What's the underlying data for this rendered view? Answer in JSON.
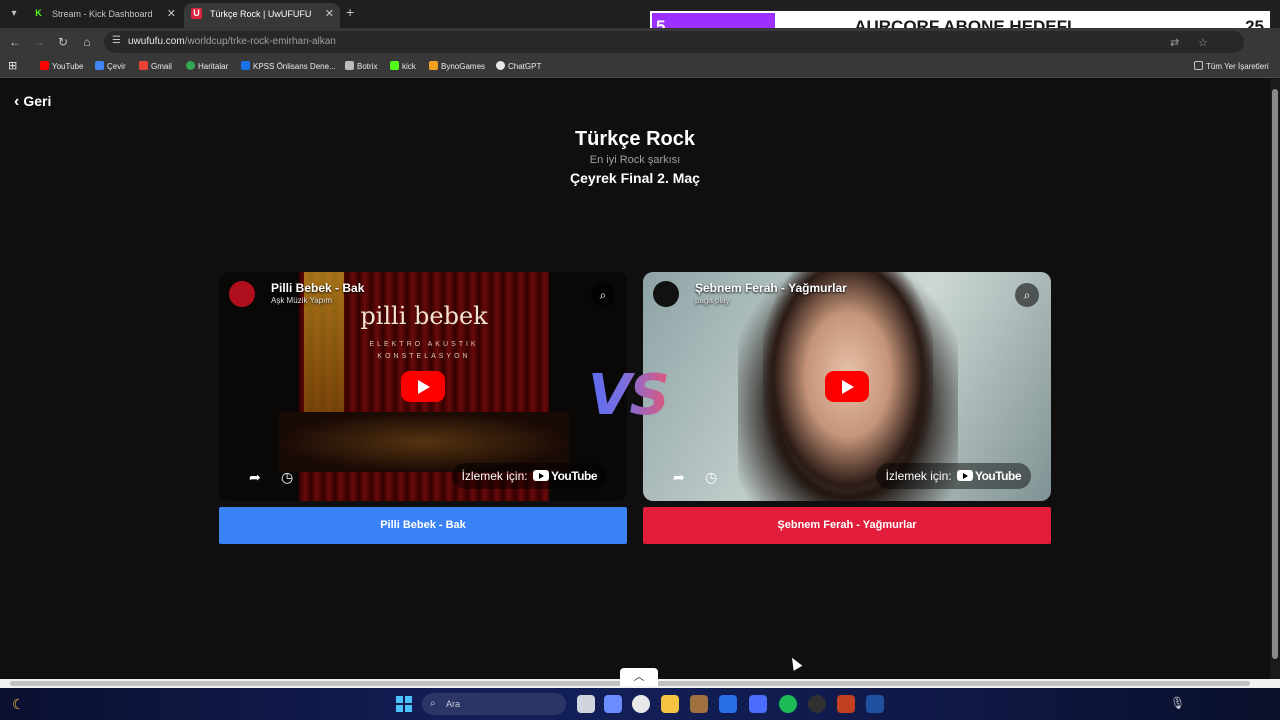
{
  "browser": {
    "tabs": [
      {
        "label": "Stream - Kick Dashboard",
        "favicon": "K"
      },
      {
        "label": "Türkçe Rock | UwUFUFU",
        "favicon": "U"
      }
    ],
    "address": {
      "host": "uwufufu.com",
      "path": "/worldcup/trke-rock-emirhan-alkan"
    },
    "bookmarks": [
      "YouTube",
      "Çevir",
      "Gmail",
      "Haritalar",
      "KPSS Önlisans Dene...",
      "Botrix",
      "kick",
      "BynoGames",
      "ChatGPT"
    ],
    "all_bookmarks": "Tüm Yer İşaretleri"
  },
  "overlay": {
    "left": "5",
    "title": "AURCORF ABONE HEDEFI",
    "right": "25"
  },
  "page": {
    "back_label": "Geri",
    "title": "Türkçe Rock",
    "subtitle": "En iyi Rock şarkısı",
    "round": "Çeyrek Final 2. Maç",
    "vs": "VS"
  },
  "videos": {
    "left": {
      "title": "Pilli Bebek - Bak",
      "author": "Aşk Müzik Yapım",
      "brand": "pilli bebek",
      "subbrand": "ELEKTRO AKUSTIK KONSTELASYON",
      "watch_label": "İzlemek için:",
      "yt_label": "YouTube",
      "choice_label": "Pilli Bebek - Bak"
    },
    "right": {
      "title": "Şebnem Ferah - Yağmurlar",
      "author": "paga play",
      "watch_label": "İzlemek için:",
      "yt_label": "YouTube",
      "choice_label": "Şebnem Ferah - Yağmurlar"
    }
  },
  "taskbar": {
    "search_placeholder": "Ara"
  },
  "colors": {
    "left_choice": "#3b82f6",
    "right_choice": "#e11d3b",
    "overlay_accent": "#9b30ff"
  }
}
